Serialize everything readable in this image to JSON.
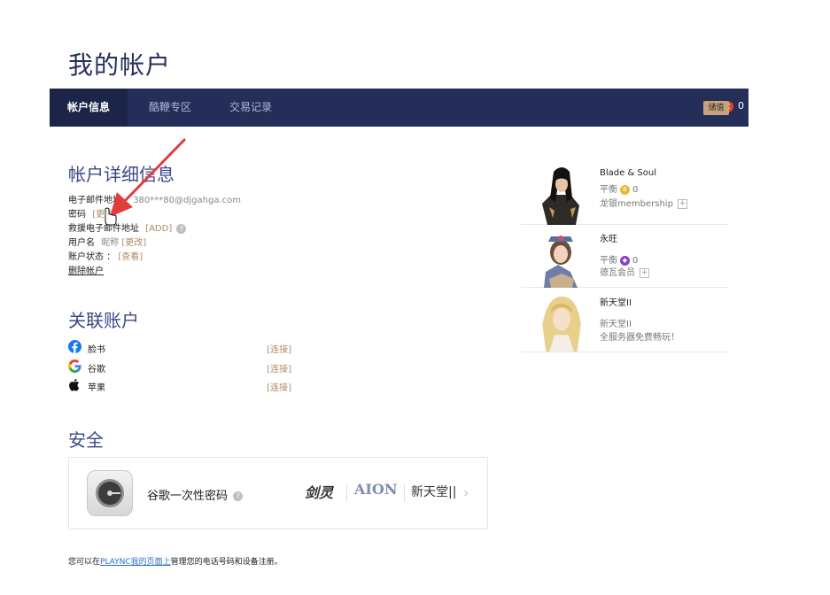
{
  "page": {
    "title": "我的帐户"
  },
  "nav": {
    "tabs": [
      {
        "label": "帐户信息",
        "active": true
      },
      {
        "label": "酷鞭专区",
        "active": false
      },
      {
        "label": "交易记录",
        "active": false
      }
    ],
    "coin_icon": "C",
    "coin_count": "0",
    "charge_label": "储值"
  },
  "account": {
    "title": "帐户详细信息",
    "email_label": "电子邮件地址",
    "email_value": "380***80@djgahga.com",
    "password_label": "密码",
    "password_link": "[更改]",
    "rescue_label": "救援电子邮件地址",
    "rescue_link": "[ADD]",
    "username_label": "用户名",
    "username_value": "昵称",
    "username_link": "[更改]",
    "status_label": "账户状态 ：",
    "status_link": "[查看]",
    "delete_label": "删除帐户"
  },
  "linked": {
    "title": "关联账户",
    "items": [
      {
        "label": "脸书",
        "action": "[连接]",
        "icon": "facebook-icon"
      },
      {
        "label": "谷歌",
        "action": "[连接]",
        "icon": "google-icon"
      },
      {
        "label": "苹果",
        "action": "[连接]",
        "icon": "apple-icon"
      }
    ]
  },
  "security": {
    "title": "安全",
    "otp_label": "谷歌一次性密码",
    "logos": [
      "剑灵",
      "AION",
      "新天堂||"
    ]
  },
  "footer": {
    "prefix": "您可以在",
    "link": "PLAYNC我的页面上",
    "suffix": "管理您的电话号码和设备注册。"
  },
  "games": [
    {
      "name": "Blade & Soul",
      "line1_label": "平衡",
      "line1_value": "0",
      "line2": "龙银membership",
      "badge_color": "#e8b830"
    },
    {
      "name": "永旺",
      "line1_label": "平衡",
      "line1_value": "0",
      "line2": "德瓦会员",
      "badge_color": "#8a3fc9"
    },
    {
      "name": "新天堂II",
      "line1_label": "新天堂II",
      "line2": "全服务器免费畅玩！"
    }
  ],
  "colors": {
    "nav_bg": "#252e58",
    "title": "#27315a",
    "section_title": "#3d4a86",
    "link": "#b08b5e",
    "annotation_arrow": "#e23b3b"
  }
}
